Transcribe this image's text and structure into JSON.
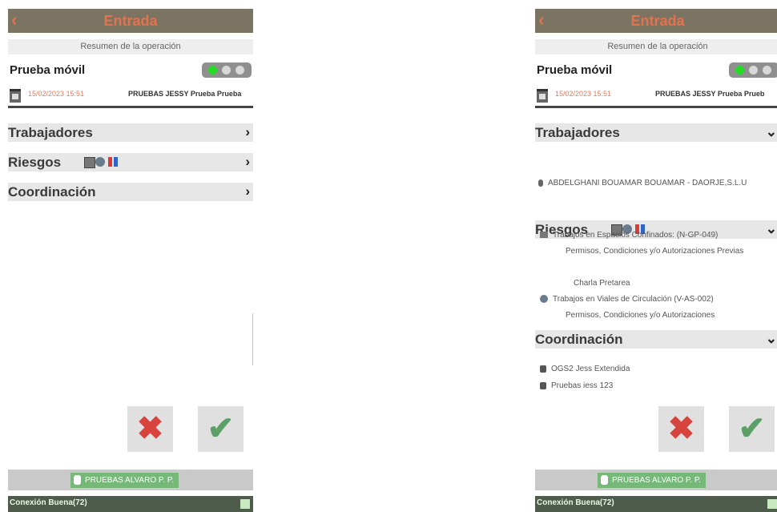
{
  "header": {
    "title": "Entrada",
    "back_icon": "‹"
  },
  "summary": "Resumen de la operación",
  "operation": {
    "title": "Prueba móvil",
    "date": "15/02/2023 15:51",
    "user_line": "PRUEBAS JESSY Prueba Prueba",
    "user_line_right_truncated": "PRUEBAS JESSY Prueba Prueb"
  },
  "sections": {
    "trabajadores": "Trabajadores",
    "riesgos": "Riesgos",
    "coordinacion": "Coordinación",
    "chevron_right": "›",
    "chevron_down": "⌄"
  },
  "trabajadores_items": [
    "ABDELGHANI BOUAMAR BOUAMAR - DAORJE,S.L.U"
  ],
  "riesgos_items": {
    "r1": "Trabajos en Espacios Confinados: (N-GP-049)",
    "r1_sub": "Permisos, Condiciones y/o Autorizaciones Previas",
    "r1_sub2": "Charla Pretarea",
    "r2": "Trabajos en Viales de Circulación (V-AS-002)",
    "r2_sub": "Permisos, Condiciones y/o Autorizaciones"
  },
  "coordinacion_items": [
    "OGS2 Jess Extendida",
    "Pruebas iess 123"
  ],
  "actions": {
    "cancel_glyph": "✖",
    "accept_glyph": "✔"
  },
  "user": "PRUEBAS ALVARO P. P.",
  "connection": "Conexión Buena(72)",
  "colors": {
    "header": "#7b7462",
    "title": "#e2734f",
    "connection_bar": "#4f5b4b",
    "user_chip": "#75b878"
  }
}
